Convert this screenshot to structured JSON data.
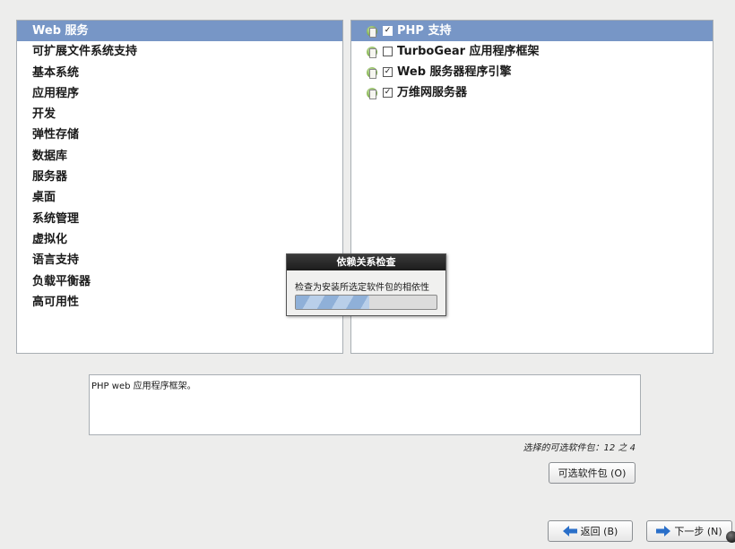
{
  "categories": [
    {
      "label": "Web 服务",
      "selected": true
    },
    {
      "label": "可扩展文件系统支持",
      "selected": false
    },
    {
      "label": "基本系统",
      "selected": false
    },
    {
      "label": "应用程序",
      "selected": false
    },
    {
      "label": "开发",
      "selected": false
    },
    {
      "label": "弹性存储",
      "selected": false
    },
    {
      "label": "数据库",
      "selected": false
    },
    {
      "label": "服务器",
      "selected": false
    },
    {
      "label": "桌面",
      "selected": false
    },
    {
      "label": "系统管理",
      "selected": false
    },
    {
      "label": "虚拟化",
      "selected": false
    },
    {
      "label": "语言支持",
      "selected": false
    },
    {
      "label": "负载平衡器",
      "selected": false
    },
    {
      "label": "高可用性",
      "selected": false
    }
  ],
  "packages": [
    {
      "label": "PHP 支持",
      "checked": true,
      "selected": true
    },
    {
      "label": "TurboGear 应用程序框架",
      "checked": false,
      "selected": false
    },
    {
      "label": "Web 服务器程序引擎",
      "checked": true,
      "selected": false
    },
    {
      "label": "万维网服务器",
      "checked": true,
      "selected": false
    }
  ],
  "progress": {
    "title": "依赖关系检查",
    "message": "检查为安装所选定软件包的相依性",
    "fraction": 0.52
  },
  "description": "PHP web 应用程序框架。",
  "selection_count": "选择的可选软件包：12 之 4",
  "buttons": {
    "optional": "可选软件包 (O)",
    "back": "返回 (B)",
    "next": "下一步 (N)"
  },
  "colors": {
    "selection": "#7796c6",
    "arrow": "#2a6fc9"
  }
}
